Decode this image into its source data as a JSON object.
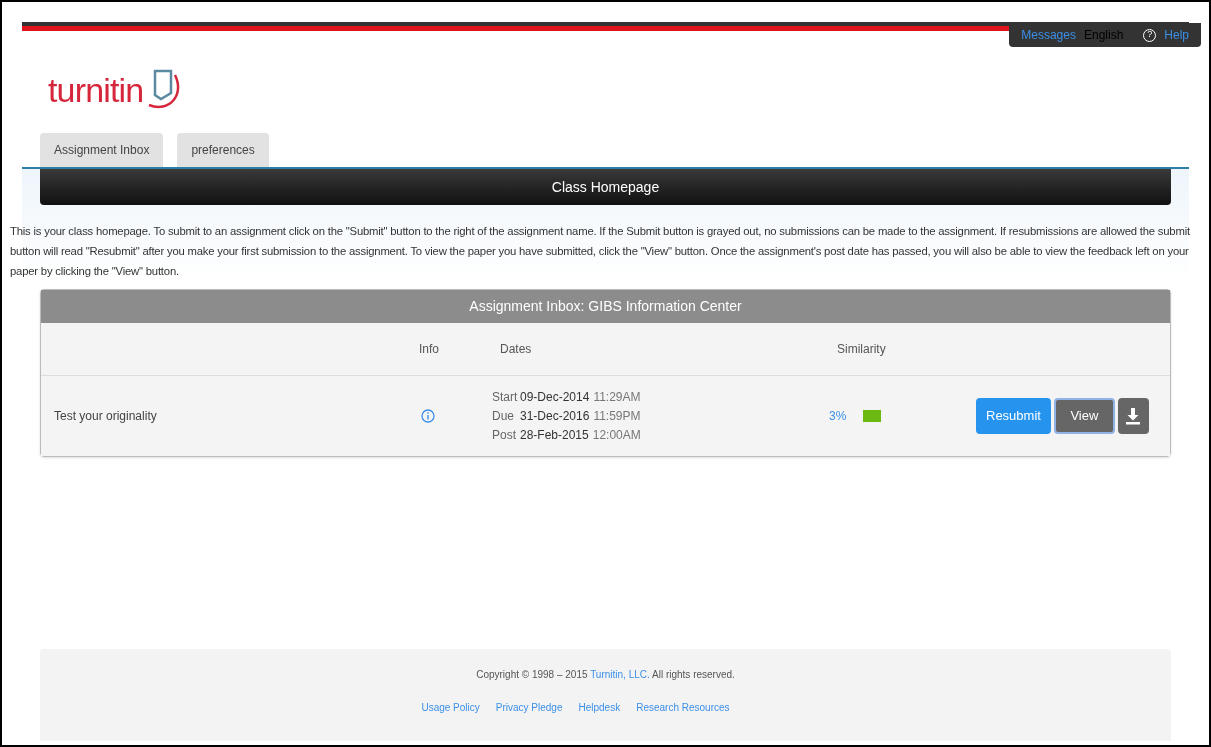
{
  "top_bar": {
    "messages": "Messages",
    "language": "English",
    "help_icon": "?",
    "help": "Help"
  },
  "logo": {
    "text": "turnitin"
  },
  "tabs": [
    {
      "label": "Assignment Inbox"
    },
    {
      "label": "preferences"
    }
  ],
  "header": {
    "title": "Class Homepage"
  },
  "intro": "This is your class homepage. To submit to an assignment click on the \"Submit\" button to the right of the assignment name. If the Submit button is grayed out, no submissions can be made to the assignment. If resubmissions are allowed the submit button will read \"Resubmit\" after you make your first submission to the assignment. To view the paper you have submitted, click the \"View\" button. Once the assignment's post date has passed, you will also be able to view the feedback left on your paper by clicking the \"View\" button.",
  "inbox": {
    "title": "Assignment Inbox: GIBS Information Center",
    "columns": [
      "Info",
      "Dates",
      "Similarity"
    ],
    "rows": [
      {
        "name": "Test your originality",
        "dates": [
          {
            "label": "Start",
            "date": "09-Dec-2014",
            "time": "11:29AM"
          },
          {
            "label": "Due",
            "date": "31-Dec-2016",
            "time": "11:59PM"
          },
          {
            "label": "Post",
            "date": "28-Feb-2015",
            "time": "12:00AM"
          }
        ],
        "similarity": "3%",
        "color": "#6cb914",
        "actions": [
          "Resubmit",
          "View"
        ]
      }
    ]
  },
  "footer": {
    "copyright_before": "Copyright © 1998 – 2015",
    "copyright_link": "Turnitin, LLC.",
    "copyright_after": "All rights reserved.",
    "links": [
      "Usage Policy",
      "Privacy Pledge",
      "Helpdesk",
      "Research Resources"
    ]
  }
}
